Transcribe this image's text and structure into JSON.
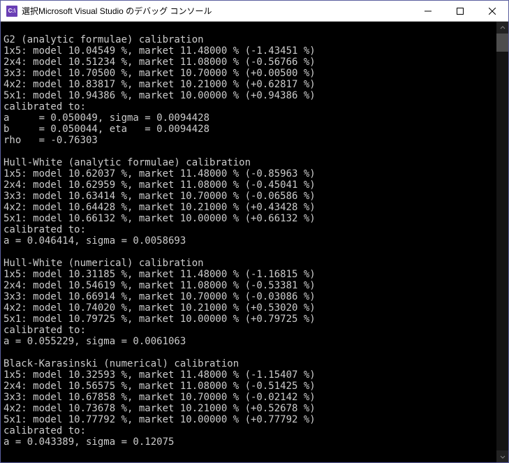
{
  "window": {
    "title": "選択Microsoft Visual Studio のデバッグ コンソール",
    "icon_label": "C:\\"
  },
  "groups": [
    {
      "heading": "G2 (analytic formulae) calibration",
      "rows": [
        {
          "tenor": "1x5",
          "model": "10.04549",
          "market": "11.48000",
          "diff": "-1.43451"
        },
        {
          "tenor": "2x4",
          "model": "10.51234",
          "market": "11.08000",
          "diff": "-0.56766"
        },
        {
          "tenor": "3x3",
          "model": "10.70500",
          "market": "10.70000",
          "diff": "+0.00500"
        },
        {
          "tenor": "4x2",
          "model": "10.83817",
          "market": "10.21000",
          "diff": "+0.62817"
        },
        {
          "tenor": "5x1",
          "model": "10.94386",
          "market": "10.00000",
          "diff": "+0.94386"
        }
      ],
      "calibrated_label": "calibrated to:",
      "param_lines": [
        "a     = 0.050049, sigma = 0.0094428",
        "b     = 0.050044, eta   = 0.0094428",
        "rho   = -0.76303"
      ]
    },
    {
      "heading": "Hull-White (analytic formulae) calibration",
      "rows": [
        {
          "tenor": "1x5",
          "model": "10.62037",
          "market": "11.48000",
          "diff": "-0.85963"
        },
        {
          "tenor": "2x4",
          "model": "10.62959",
          "market": "11.08000",
          "diff": "-0.45041"
        },
        {
          "tenor": "3x3",
          "model": "10.63414",
          "market": "10.70000",
          "diff": "-0.06586"
        },
        {
          "tenor": "4x2",
          "model": "10.64428",
          "market": "10.21000",
          "diff": "+0.43428"
        },
        {
          "tenor": "5x1",
          "model": "10.66132",
          "market": "10.00000",
          "diff": "+0.66132"
        }
      ],
      "calibrated_label": "calibrated to:",
      "param_lines": [
        "a = 0.046414, sigma = 0.0058693"
      ]
    },
    {
      "heading": "Hull-White (numerical) calibration",
      "rows": [
        {
          "tenor": "1x5",
          "model": "10.31185",
          "market": "11.48000",
          "diff": "-1.16815"
        },
        {
          "tenor": "2x4",
          "model": "10.54619",
          "market": "11.08000",
          "diff": "-0.53381"
        },
        {
          "tenor": "3x3",
          "model": "10.66914",
          "market": "10.70000",
          "diff": "-0.03086"
        },
        {
          "tenor": "4x2",
          "model": "10.74020",
          "market": "10.21000",
          "diff": "+0.53020"
        },
        {
          "tenor": "5x1",
          "model": "10.79725",
          "market": "10.00000",
          "diff": "+0.79725"
        }
      ],
      "calibrated_label": "calibrated to:",
      "param_lines": [
        "a = 0.055229, sigma = 0.0061063"
      ]
    },
    {
      "heading": "Black-Karasinski (numerical) calibration",
      "rows": [
        {
          "tenor": "1x5",
          "model": "10.32593",
          "market": "11.48000",
          "diff": "-1.15407"
        },
        {
          "tenor": "2x4",
          "model": "10.56575",
          "market": "11.08000",
          "diff": "-0.51425"
        },
        {
          "tenor": "3x3",
          "model": "10.67858",
          "market": "10.70000",
          "diff": "-0.02142"
        },
        {
          "tenor": "4x2",
          "model": "10.73678",
          "market": "10.21000",
          "diff": "+0.52678"
        },
        {
          "tenor": "5x1",
          "model": "10.77792",
          "market": "10.00000",
          "diff": "+0.77792"
        }
      ],
      "calibrated_label": "calibrated to:",
      "param_lines": [
        "a = 0.043389, sigma = 0.12075"
      ]
    }
  ]
}
